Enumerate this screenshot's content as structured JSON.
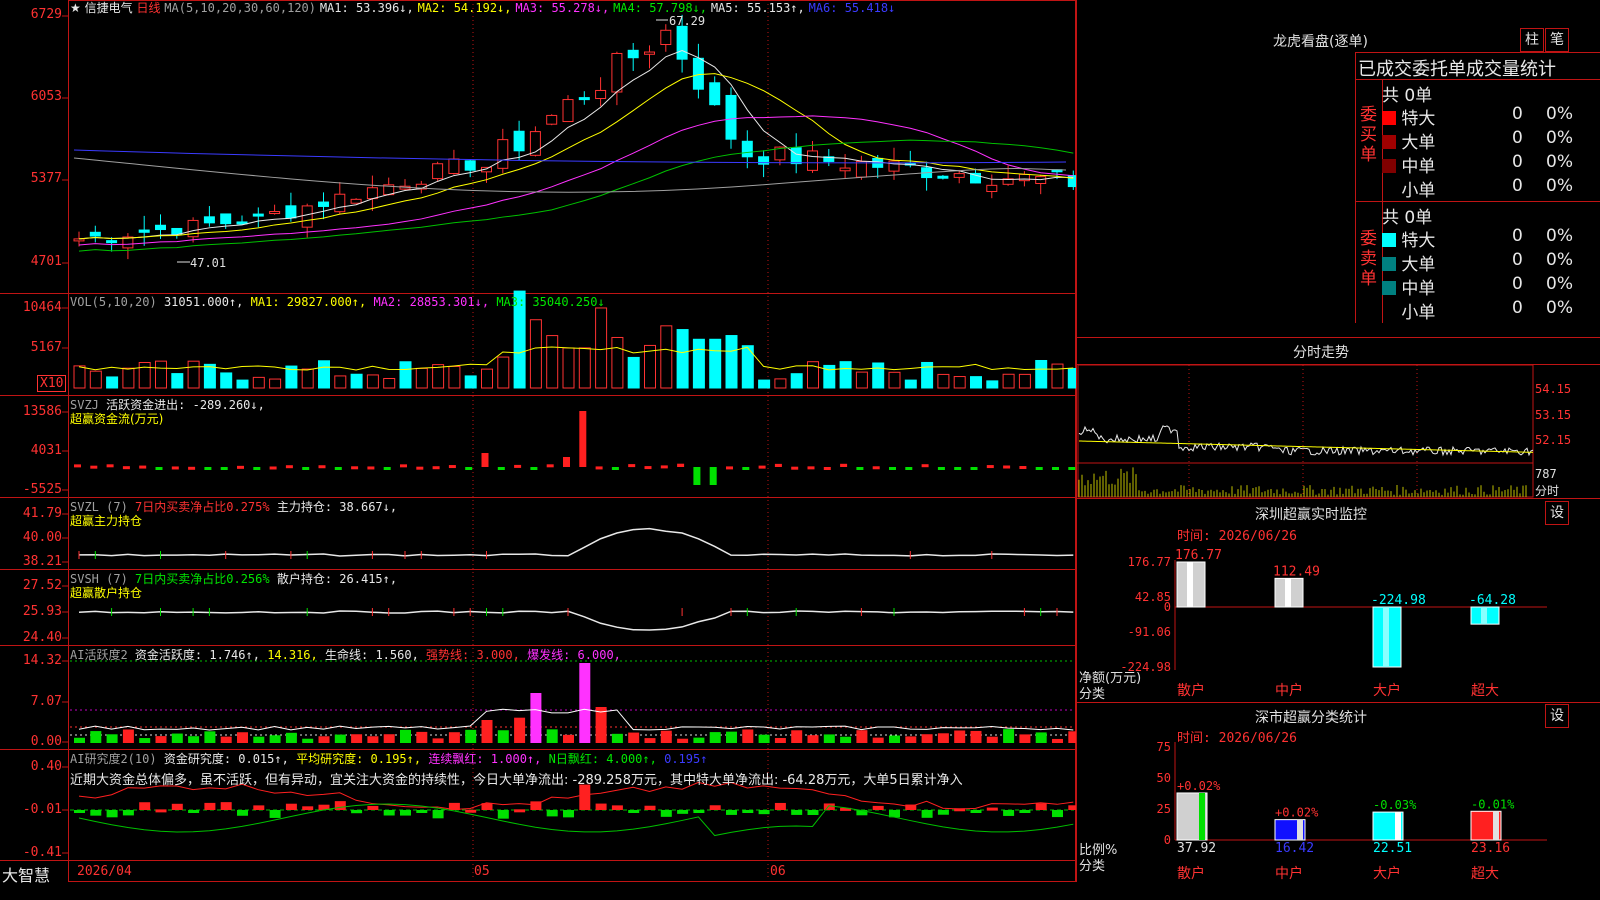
{
  "header": {
    "star": "★",
    "stock_name": "信捷电气",
    "period": "日线",
    "ma_title": "MA(5,10,20,30,60,120)",
    "ma1": "MA1: 53.396↓,",
    "ma2": "MA2: 54.192↓,",
    "ma3": "MA3: 55.278↓,",
    "ma4": "MA4: 57.798↓,",
    "ma5": "MA5: 55.153↑,",
    "ma6": "MA6: 55.418↓"
  },
  "price_axis": [
    "6729",
    "6053",
    "5377",
    "4701"
  ],
  "price_high": "67.29",
  "price_low": "47.01",
  "vol": {
    "title": "VOL(5,10,20)",
    "val": "31051.000↑,",
    "ma1": "MA1: 29827.000↑,",
    "ma2": "MA2: 28853.301↓,",
    "ma3": "MA3: 35040.250↓",
    "axis": [
      "10464",
      "5167"
    ],
    "unit": "X10"
  },
  "svzj": {
    "title": "SVZJ",
    "line": "活跃资金进出: -289.260↓,",
    "sub": "超赢资金流(万元)",
    "axis": [
      "13586",
      "4031",
      "-5525"
    ]
  },
  "svzl": {
    "title": "SVZL (7)",
    "pct": "7日内买卖净占比0.275%",
    "line": "主力持仓: 38.667↓,",
    "sub": "超赢主力持仓",
    "axis": [
      "41.79",
      "40.00",
      "38.21"
    ]
  },
  "svsh": {
    "title": "SVSH (7)",
    "pct": "7日内买卖净占比0.256%",
    "line": "散户持仓: 26.415↑,",
    "sub": "超赢散户持仓",
    "axis": [
      "27.52",
      "25.93",
      "24.40"
    ]
  },
  "ai1": {
    "title": "AI活跃度2",
    "a": "资金活跃度: 1.746↑,",
    "b": "14.316,",
    "c": "生命线: 1.560,",
    "d": "强势线: 3.000,",
    "e": "爆发线: 6.000,",
    "axis": [
      "14.32",
      "7.07",
      "0.00"
    ]
  },
  "ai2": {
    "title": "AI研究度2(10)",
    "a": "资金研究度: 0.015↑,",
    "b": "平均研究度: 0.195↑,",
    "c": "连续飘红: 1.000↑,",
    "d": "N日飘红: 4.000↑,",
    "e": "0.195↑",
    "note": "近期大资金总体偏多，虽不活跃，但有异动，宜关注大资金的持续性，今日大单净流出: -289.258万元，其中特大单净流出: -64.28万元，大单5日累计净入",
    "axis": [
      "0.40",
      "-0.01",
      "-0.41"
    ]
  },
  "footer": {
    "logo": "大智慧",
    "d1": "2026/04",
    "d2": "05",
    "d3": "06"
  },
  "right": {
    "lhkp_title": "龙虎看盘(逐单)",
    "btn_zhu": "柱",
    "btn_bi": "笔",
    "table_head": "已成交委托单成交量统计",
    "buy_label": "委买单",
    "sell_label": "委卖单",
    "buy_total": "共 0单",
    "sell_total": "共 0单",
    "rows": [
      {
        "name": "特大",
        "n": "0",
        "p": "0%"
      },
      {
        "name": "大单",
        "n": "0",
        "p": "0%"
      },
      {
        "name": "中单",
        "n": "0",
        "p": "0%"
      },
      {
        "name": "小单",
        "n": "0",
        "p": "0%"
      }
    ],
    "colors": {
      "buy": [
        "#ff0000",
        "#a00000",
        "#800000"
      ],
      "sell": [
        "#00ffff",
        "#008080",
        "#008080"
      ]
    },
    "fenshi_title": "分时走势",
    "fenshi_axis": [
      "54.15",
      "53.15",
      "52.15"
    ],
    "fenshi_vol": "787",
    "fenshi_unit": "分时",
    "sz_title": "深圳超赢实时监控",
    "sz_btn": "设",
    "sz_time": "时间: 2026/06/26",
    "sz_axis": [
      "176.77",
      "42.85",
      "0",
      "-91.06",
      "-224.98"
    ],
    "sz_bars": [
      {
        "cat": "散户",
        "val": 176.77,
        "label": "176.77"
      },
      {
        "cat": "中户",
        "val": 112.49,
        "label": "112.49"
      },
      {
        "cat": "大户",
        "val": -224.98,
        "label": "-224.98"
      },
      {
        "cat": "超大",
        "val": -64.28,
        "label": "-64.28"
      }
    ],
    "sz_ylabel": "净额(万元)",
    "sz_xlabel": "分类",
    "ss_title": "深市超赢分类统计",
    "ss_btn": "设",
    "ss_time": "时间: 2026/06/26",
    "ss_axis": [
      "75",
      "50",
      "25",
      "0"
    ],
    "ss_bars": [
      {
        "cat": "散户",
        "val": 37.92,
        "pct": "+0.02%"
      },
      {
        "cat": "中户",
        "val": 16.42,
        "pct": "+0.02%"
      },
      {
        "cat": "大户",
        "val": 22.51,
        "pct": "-0.03%"
      },
      {
        "cat": "超大",
        "val": 23.16,
        "pct": "-0.01%"
      }
    ],
    "ss_ylabel": "比例%",
    "ss_xlabel": "分类"
  }
}
